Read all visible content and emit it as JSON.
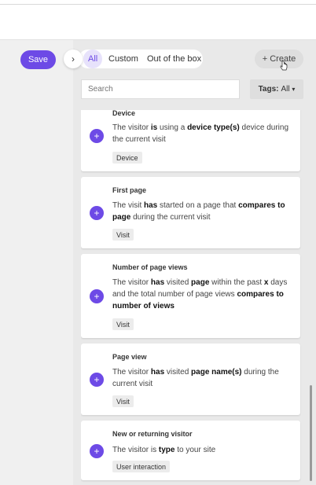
{
  "toolbar": {
    "save_label": "Save"
  },
  "filters": {
    "collapse_glyph": "›",
    "tabs": [
      "All",
      "Custom",
      "Out of the box"
    ],
    "create_label": "+ Create"
  },
  "search": {
    "placeholder": "Search"
  },
  "tags": {
    "label": "Tags:",
    "value": "All",
    "caret": "▾"
  },
  "cards": [
    {
      "title": "Device",
      "desc_html": "The visitor <b>is</b> using a <b>device type(s)</b> device during the current visit",
      "tag": "Device"
    },
    {
      "title": "First page",
      "desc_html": "The visit <b>has</b> started on a page that <b>compares to page</b> during the current visit",
      "tag": "Visit"
    },
    {
      "title": "Number of page views",
      "desc_html": "The visitor <b>has</b> visited <b>page</b> within the past <b>x</b> days and the total number of page views <b>compares to number of views</b>",
      "tag": "Visit"
    },
    {
      "title": "Page view",
      "desc_html": "The visitor <b>has</b> visited <b>page name(s)</b> during the current visit",
      "tag": "Visit"
    },
    {
      "title": "New or returning visitor",
      "desc_html": "The visitor is <b>type</b> to your site",
      "tag": "User interaction"
    }
  ],
  "colors": {
    "accent": "#6d4ae6"
  }
}
